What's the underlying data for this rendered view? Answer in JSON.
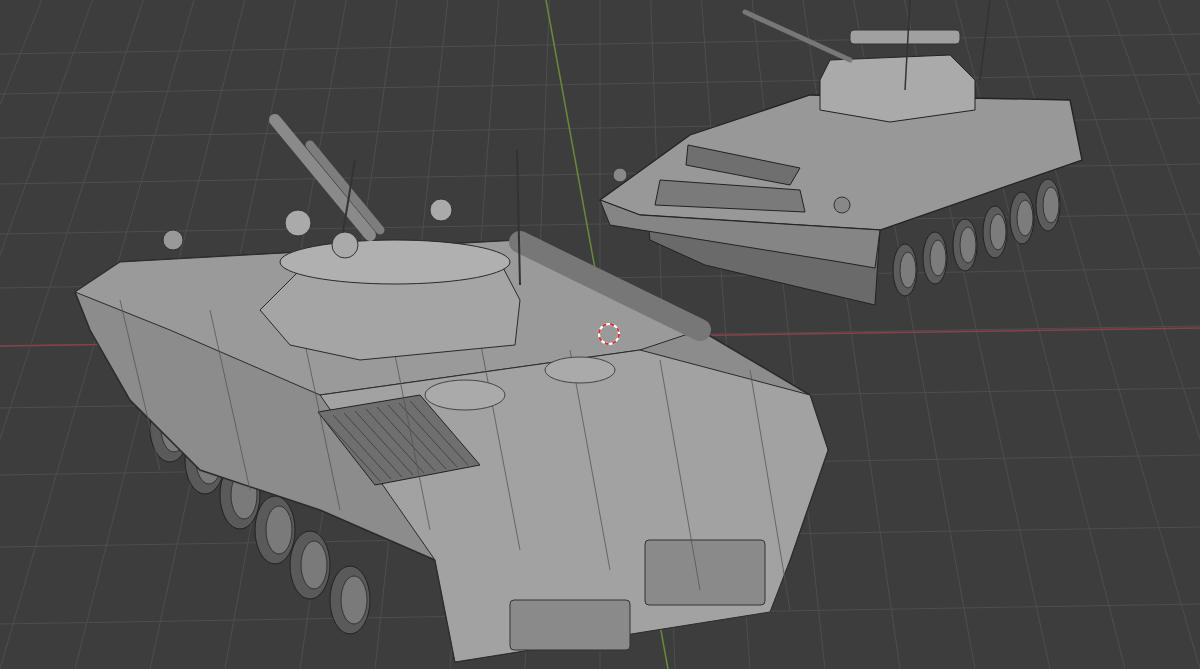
{
  "viewport": {
    "grid_visible": true,
    "axes_visible": true,
    "cursor_visible": true
  },
  "objects": [
    {
      "kind": "tank"
    },
    {
      "kind": "tank"
    }
  ]
}
